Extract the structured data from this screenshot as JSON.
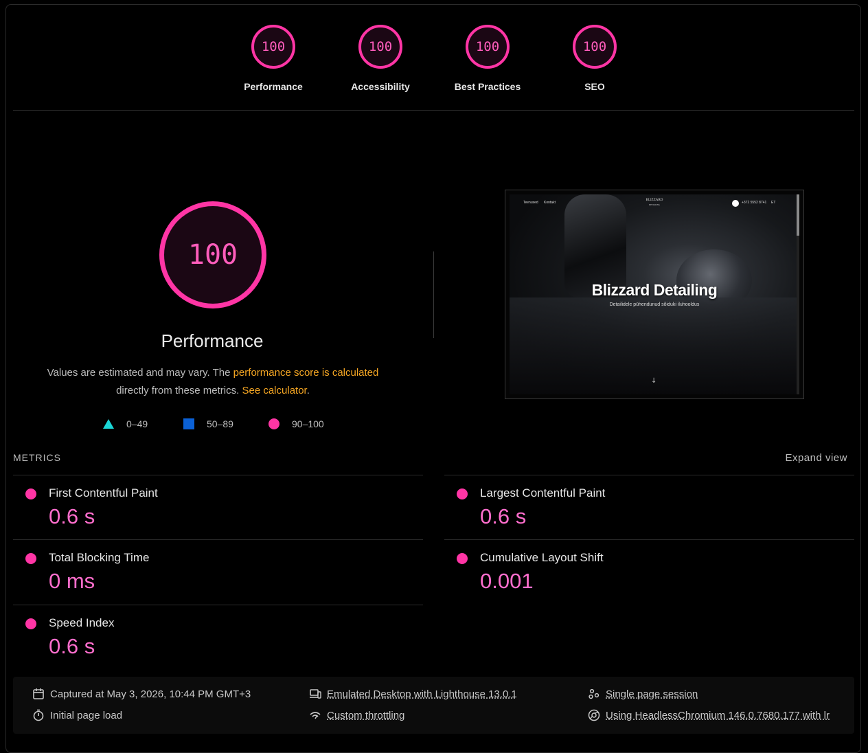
{
  "categories": [
    {
      "score": "100",
      "label": "Performance"
    },
    {
      "score": "100",
      "label": "Accessibility"
    },
    {
      "score": "100",
      "label": "Best Practices"
    },
    {
      "score": "100",
      "label": "SEO"
    }
  ],
  "main": {
    "score": "100",
    "title": "Performance",
    "desc_1": "Values are estimated and may vary. The ",
    "desc_link_1": "performance score is calculated",
    "desc_2": " directly from these metrics. ",
    "desc_link_2": "See calculator",
    "desc_3": "."
  },
  "legend": [
    {
      "shape": "triangle",
      "range": "0–49",
      "color": "#1ad6d6"
    },
    {
      "shape": "square",
      "range": "50–89",
      "color": "#0b61d6"
    },
    {
      "shape": "circle",
      "range": "90–100",
      "color": "#ff35a5"
    }
  ],
  "screenshot": {
    "nav_1": "Teenused",
    "nav_2": "Kontakt",
    "logo_1": "BLIZZARD",
    "logo_2": "DETAILING",
    "phone": "+372 5552 8741",
    "lang": "ET",
    "title": "Blizzard Detailing",
    "subtitle": "Detailidele pühendunud sõiduki iluhooldus",
    "scroll_arrow": "↓"
  },
  "metrics_header": "METRICS",
  "expand_view": "Expand view",
  "metrics": [
    {
      "name": "First Contentful Paint",
      "value": "0.6 s"
    },
    {
      "name": "Largest Contentful Paint",
      "value": "0.6 s"
    },
    {
      "name": "Total Blocking Time",
      "value": "0 ms"
    },
    {
      "name": "Cumulative Layout Shift",
      "value": "0.001"
    },
    {
      "name": "Speed Index",
      "value": "0.6 s"
    }
  ],
  "footer": {
    "captured": "Captured at May 3, 2026, 10:44 PM GMT+3",
    "load": "Initial page load",
    "emulated": "Emulated Desktop with Lighthouse 13.0.1",
    "throttling": "Custom throttling",
    "session": "Single page session",
    "browser": "Using HeadlessChromium 146.0.7680.177 with lr"
  },
  "colors": {
    "pass": "#ff35a5",
    "pass_text": "#ff6ecd",
    "link": "#f5a623",
    "background": "#000000"
  }
}
